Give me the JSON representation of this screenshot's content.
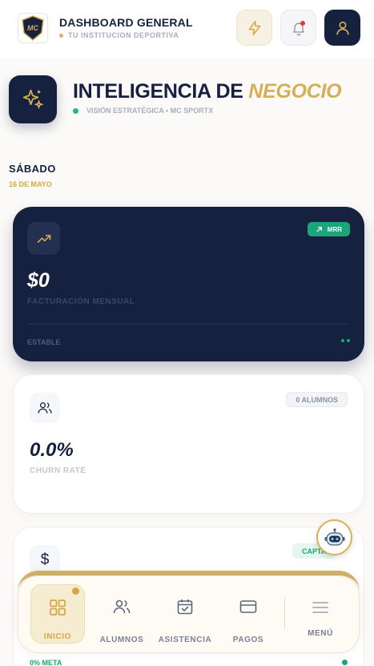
{
  "header": {
    "title": "DASHBOARD GENERAL",
    "subtitle": "TU INSTITUCION DEPORTIVA",
    "logo_text": "MC",
    "buttons": [
      "bolt-icon",
      "bell-icon",
      "user-icon"
    ]
  },
  "hero": {
    "title_main": "INTELIGENCIA DE ",
    "title_accent": "NEGOCIO",
    "subtitle": "VISIÓN ESTRATÉGICA • MC SPORTX"
  },
  "date": {
    "day": "SÁBADO",
    "date": "16 DE MAYO"
  },
  "cards": {
    "revenue": {
      "badge": "MRR",
      "value": "$0",
      "label": "FACTURACIÓN MENSUAL",
      "status": "ESTABLE"
    },
    "churn": {
      "badge": "0 ALUMNOS",
      "value": "0.0%",
      "label": "CHURN RATE"
    },
    "third": {
      "badge": "CAPTA",
      "meta": "0% META"
    }
  },
  "nav": {
    "items": [
      {
        "label": "INICIO",
        "icon": "grid-icon",
        "active": true
      },
      {
        "label": "ALUMNOS",
        "icon": "users-icon"
      },
      {
        "label": "ASISTENCIA",
        "icon": "calendar-check-icon"
      },
      {
        "label": "PAGOS",
        "icon": "credit-card-icon"
      },
      {
        "label": "MENÚ",
        "icon": "menu-icon"
      }
    ]
  },
  "colors": {
    "navy": "#16213f",
    "gold": "#d4af55",
    "green": "#1aa67a",
    "background": "#fbfaf8"
  }
}
